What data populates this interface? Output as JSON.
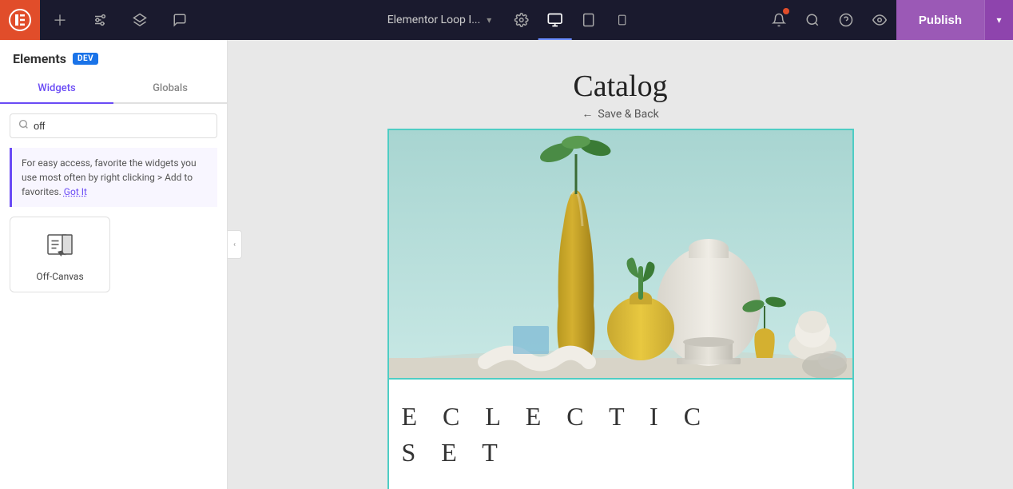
{
  "topbar": {
    "logo_icon": "elementor-logo",
    "add_icon": "plus-icon",
    "settings_icon": "sliders-icon",
    "layers_icon": "layers-icon",
    "chat_icon": "chat-icon",
    "doc_title": "Elementor Loop I...",
    "chevron_icon": "chevron-down-icon",
    "gear_icon": "gear-icon",
    "desktop_icon": "desktop-icon",
    "tablet_icon": "tablet-icon",
    "phone_icon": "phone-icon",
    "notif_icon": "bell-icon",
    "search_icon": "search-icon",
    "help_icon": "help-icon",
    "eye_icon": "eye-icon",
    "publish_label": "Publish",
    "publish_chevron": "chevron-down-icon"
  },
  "sidebar": {
    "title": "Elements",
    "dev_badge": "DEV",
    "tabs": [
      {
        "label": "Widgets",
        "active": true
      },
      {
        "label": "Globals",
        "active": false
      }
    ],
    "search_placeholder": "off",
    "search_value": "off",
    "tip_text": "For easy access, favorite the widgets you use most often by right clicking > Add to favorites.",
    "tip_link": "Got It",
    "widgets": [
      {
        "label": "Off-Canvas",
        "icon": "off-canvas-icon"
      }
    ]
  },
  "canvas": {
    "page_title": "Catalog",
    "nav_back_label": "Save & Back",
    "product_card": {
      "image_alt": "Eclectic decorative vases product photo",
      "title_line1": "E C L E C T I C",
      "title_line2": "S E T"
    }
  }
}
